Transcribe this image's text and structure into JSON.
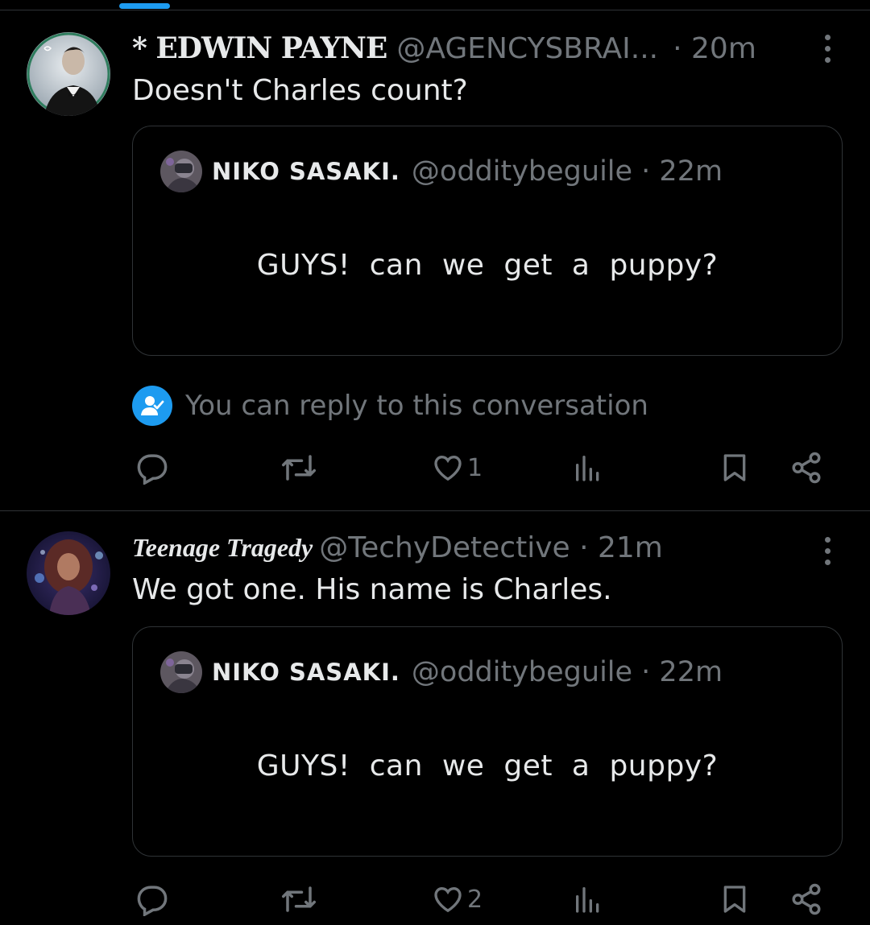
{
  "tweets": [
    {
      "display_name": "* EDWIN PAYNE",
      "handle": "@AGENCYSBRAI...",
      "time": "· 20m",
      "text": "Doesn't Charles count?",
      "avatar_icon": "man-in-tuxedo-avatar",
      "quote": {
        "display_name": "NIKO SASAKI.",
        "handle": "@odditybeguile · 22m",
        "text": "GUYS! can we get a puppy?"
      },
      "reply_notice": "You can reply to this conversation",
      "likes": "1"
    },
    {
      "display_name": "Teenage Tragedy",
      "handle": "@TechyDetective · 21m",
      "time": "",
      "text": "We got one. His name is Charles.",
      "avatar_icon": "woman-portrait-avatar",
      "quote": {
        "display_name": "NIKO SASAKI.",
        "handle": "@odditybeguile · 22m",
        "text": "GUYS! can we get a puppy?"
      },
      "likes": "2"
    }
  ],
  "colors": {
    "accent": "#1d9bf0",
    "muted": "#71767b",
    "border": "#2f3336",
    "background": "#000000"
  }
}
